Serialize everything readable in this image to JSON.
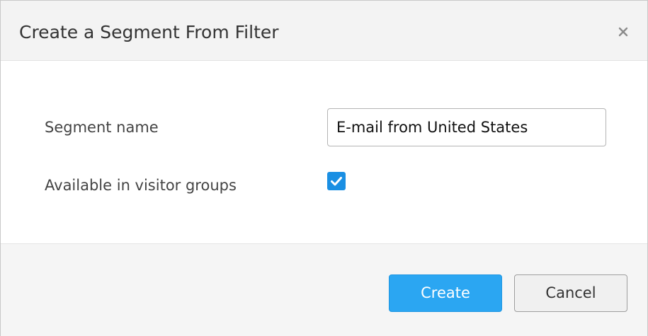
{
  "dialog": {
    "title": "Create a Segment From Filter",
    "close_icon": "close-icon"
  },
  "form": {
    "segment_name_label": "Segment name",
    "segment_name_value": "E-mail from United States",
    "visitor_groups_label": "Available in visitor groups",
    "visitor_groups_checked": true,
    "checkbox_icon": "checkmark-icon"
  },
  "buttons": {
    "create_label": "Create",
    "cancel_label": "Cancel"
  },
  "colors": {
    "primary": "#2ba6f2",
    "checkbox": "#1a8fe3",
    "header_bg": "#f3f3f3",
    "footer_bg": "#f5f5f5"
  }
}
